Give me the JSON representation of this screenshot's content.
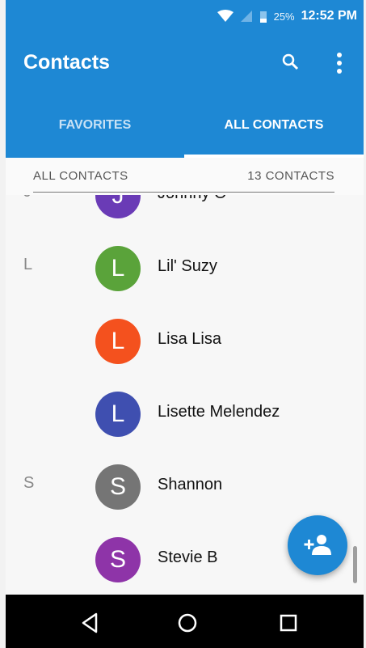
{
  "status": {
    "battery": "25%",
    "time": "12:52 PM"
  },
  "appbar": {
    "title": "Contacts",
    "search_icon": "search-icon",
    "more_icon": "more-vert-icon"
  },
  "tabs": [
    {
      "label": "FAVORITES",
      "selected": false
    },
    {
      "label": "ALL CONTACTS",
      "selected": true
    }
  ],
  "list_header": {
    "left": "ALL CONTACTS",
    "right": "13 CONTACTS"
  },
  "contacts": [
    {
      "letter": "J",
      "initial": "J",
      "name": "Johnny O",
      "color": "#6a3bb6"
    },
    {
      "letter": "L",
      "initial": "L",
      "name": "Lil' Suzy",
      "color": "#5aa33a"
    },
    {
      "letter": "",
      "initial": "L",
      "name": "Lisa Lisa",
      "color": "#f4511e"
    },
    {
      "letter": "",
      "initial": "L",
      "name": "Lisette Melendez",
      "color": "#3f4fb0"
    },
    {
      "letter": "S",
      "initial": "S",
      "name": "Shannon",
      "color": "#757575"
    },
    {
      "letter": "",
      "initial": "S",
      "name": "Stevie B",
      "color": "#8e34a8"
    }
  ],
  "fab": {
    "icon": "add-contact-icon"
  },
  "navbar": {
    "icons": [
      "back-icon",
      "home-icon",
      "recents-icon"
    ]
  }
}
